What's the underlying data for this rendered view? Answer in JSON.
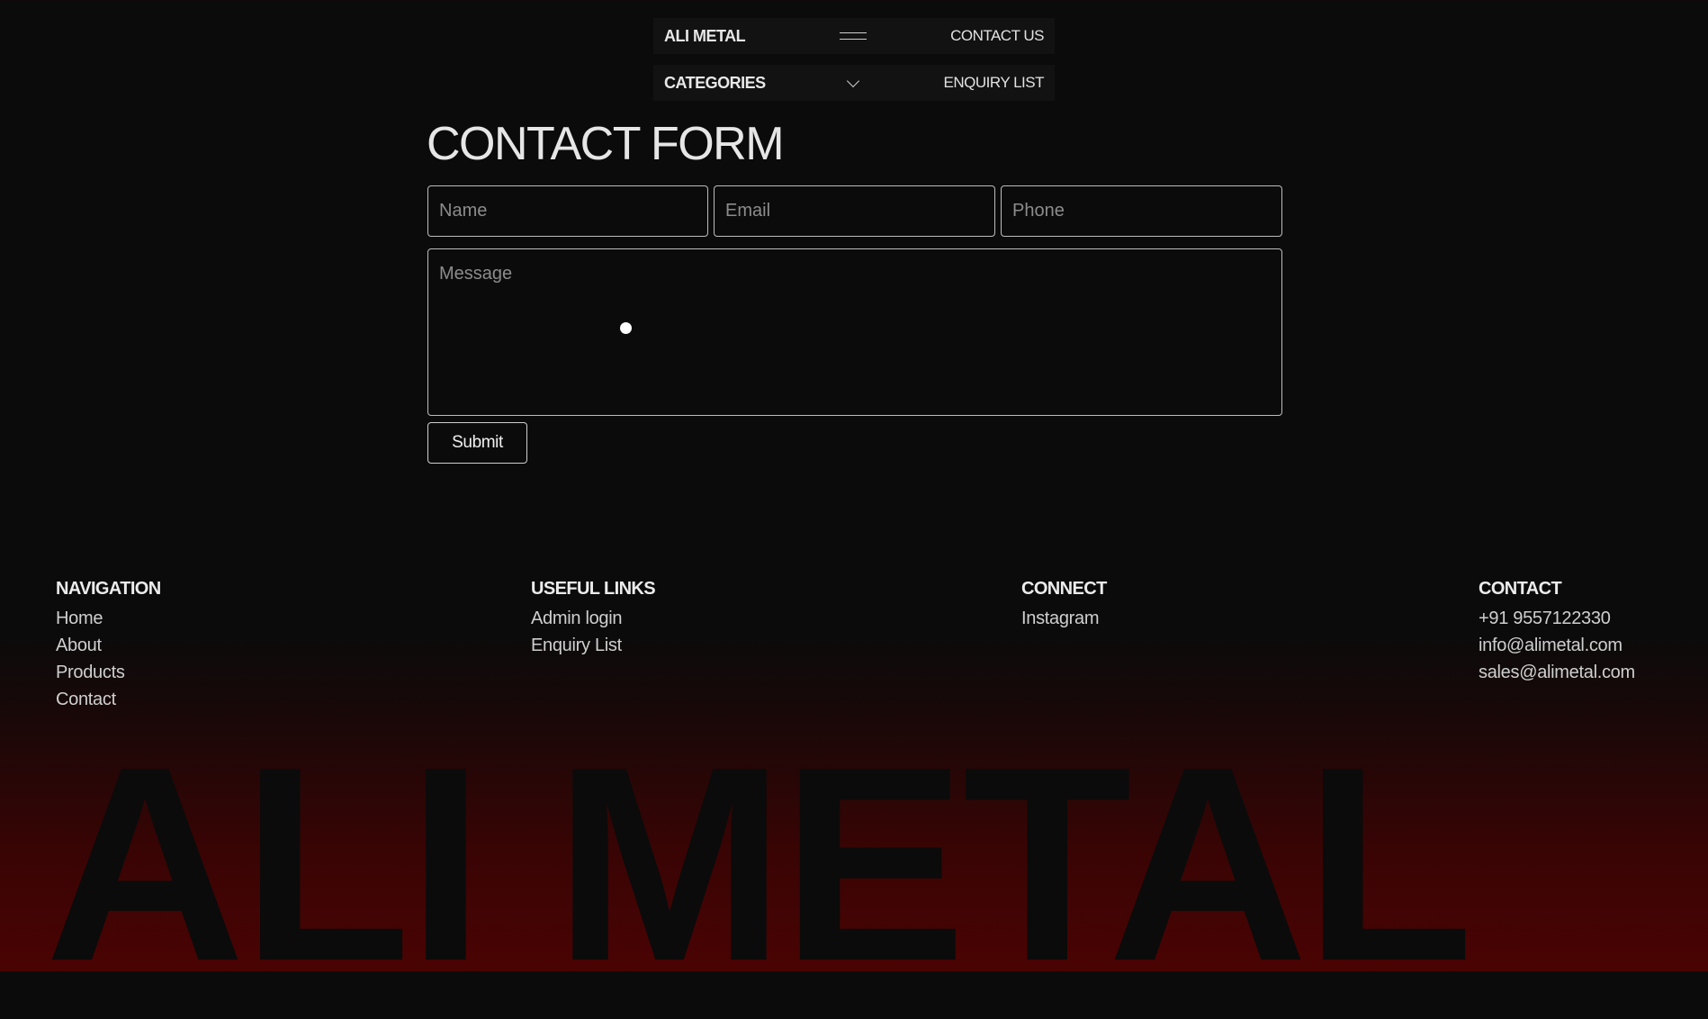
{
  "header": {
    "brand": "ALI METAL",
    "contact_link": "CONTACT US",
    "categories_label": "CATEGORIES",
    "enquiry_link": "ENQUIRY LIST",
    "menu_icon": "hamburger-icon",
    "categories_icon": "chevron-down-icon"
  },
  "form": {
    "title": "CONTACT FORM",
    "name_placeholder": "Name",
    "email_placeholder": "Email",
    "phone_placeholder": "Phone",
    "message_placeholder": "Message",
    "submit_label": "Submit"
  },
  "footer": {
    "navigation": {
      "heading": "NAVIGATION",
      "items": [
        "Home",
        "About",
        "Products",
        "Contact"
      ]
    },
    "useful_links": {
      "heading": "USEFUL LINKS",
      "items": [
        "Admin login",
        "Enquiry List"
      ]
    },
    "connect": {
      "heading": "CONNECT",
      "items": [
        "Instagram"
      ]
    },
    "contact": {
      "heading": "CONTACT",
      "items": [
        "+91 9557122330",
        "info@alimetal.com",
        "sales@alimetal.com"
      ]
    },
    "wordmark": "ALI METAL"
  },
  "colors": {
    "background": "#0b0b0b",
    "gradient_red": "#4a0303",
    "text": "#e6e6e6"
  }
}
